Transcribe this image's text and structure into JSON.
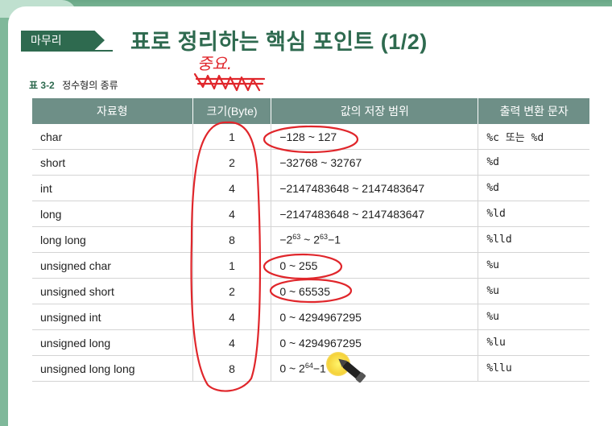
{
  "slide": {
    "badge": "마무리",
    "title": "표로 정리하는 핵심 포인트 (1/2)",
    "caption_tag": "표",
    "caption_num": "3-2",
    "caption_text": "정수형의 종류"
  },
  "table": {
    "headers": [
      "자료형",
      "크기(Byte)",
      "값의 저장 범위",
      "출력 변환 문자"
    ],
    "rows": [
      {
        "type": "char",
        "size": "1",
        "range": "−128 ~ 127",
        "fmt": "%c 또는 %d"
      },
      {
        "type": "short",
        "size": "2",
        "range": "−32768 ~ 32767",
        "fmt": "%d"
      },
      {
        "type": "int",
        "size": "4",
        "range": "−2147483648 ~ 2147483647",
        "fmt": "%d"
      },
      {
        "type": "long",
        "size": "4",
        "range": "−2147483648 ~ 2147483647",
        "fmt": "%ld"
      },
      {
        "type": "long long",
        "size": "8",
        "range_base1": "−2",
        "range_exp1": "63",
        "range_mid": " ~ 2",
        "range_exp2": "63",
        "range_tail": "−1",
        "fmt": "%lld"
      },
      {
        "type": "unsigned char",
        "size": "1",
        "range": "0 ~ 255",
        "fmt": "%u"
      },
      {
        "type": "unsigned short",
        "size": "2",
        "range": "0 ~ 65535",
        "fmt": "%u"
      },
      {
        "type": "unsigned int",
        "size": "4",
        "range": "0 ~ 4294967295",
        "fmt": "%u"
      },
      {
        "type": "unsigned long",
        "size": "4",
        "range": "0 ~ 4294967295",
        "fmt": "%lu"
      },
      {
        "type": "unsigned long long",
        "size": "8",
        "range_base1": "0 ~ 2",
        "range_exp1": "64",
        "range_tail": "−1",
        "fmt": "%llu"
      }
    ]
  },
  "annotations": {
    "handwritten_note": "중요",
    "ink_color": "#e0262b"
  }
}
